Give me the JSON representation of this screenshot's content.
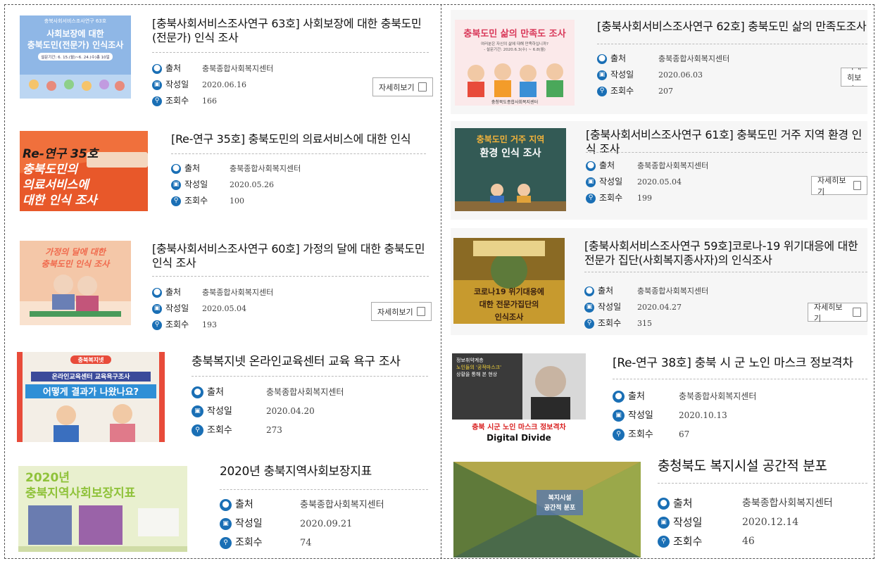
{
  "labels": {
    "source": "출처",
    "date": "작성일",
    "views": "조회수",
    "more": "자세히보기"
  },
  "left": [
    {
      "title": "[충북사회서비스조사연구 63호] 사회보장에 대한 충북도민(전문가) 인식 조사",
      "source": "충북종합사회복지센터",
      "date": "2020.06.16",
      "views": "166",
      "thumb": {
        "line1": "사회보장에 대한",
        "line2": "충북도민(전문가) 인식조사",
        "top": "충북사회서비스조사연구 63호",
        "sub": "설문기간: 6. 15.(월)~6. 24.(수)총 10일"
      }
    },
    {
      "title": "[Re-연구 35호] 충북도민의 의료서비스에 대한 인식",
      "source": "충북종합사회복지센터",
      "date": "2020.05.26",
      "views": "100",
      "thumb": {
        "line1": "Re-연구 35호",
        "line2": "충북도민의",
        "line3": "의료서비스에",
        "line4": "대한 인식 조사"
      }
    },
    {
      "title": "[충북사회서비스조사연구 60호] 가정의 달에 대한 충북도민 인식 조사",
      "source": "충북종합사회복지센터",
      "date": "2020.05.04",
      "views": "193",
      "thumb": {
        "line1": "가정의 달에 대한",
        "line2": "충북도민 인식 조사"
      }
    },
    {
      "title": "충북복지넷 온라인교육센터 교육 욕구 조사",
      "source": "충북종합사회복지센터",
      "date": "2020.04.20",
      "views": "273",
      "thumb": {
        "tag": "충북복지넷",
        "line1": "온라인교육센터 교육욕구조사",
        "line2": "어떻게 결과가 나왔나요?"
      }
    },
    {
      "title": "2020년 충북지역사회보장지표",
      "source": "충북종합사회복지센터",
      "date": "2020.09.21",
      "views": "74",
      "thumb": {
        "line1": "2020년",
        "line2": "충북지역사회보장지표"
      }
    }
  ],
  "right": [
    {
      "title": "[충북사회서비스조사연구 62호] 충북도민 삶의 만족도조사",
      "source": "충북종합사회복지센터",
      "date": "2020.06.03",
      "views": "207",
      "thumb": {
        "line1": "충북도민 삶의 만족도 조사",
        "sub": "여러분은 자신의 삶에 대해 만족하십니까?",
        "sub2": "- 설문기간: 2020.6.3(수) ~ 6.8(월)",
        "foot": "충청북도종합사회복지센터"
      }
    },
    {
      "title": "[충북사회서비스조사연구 61호] 충북도민 거주 지역 환경 인식 조사",
      "source": "충북종합사회복지센터",
      "date": "2020.05.04",
      "views": "199",
      "thumb": {
        "line1": "충북도민 거주 지역",
        "line2": "환경 인식 조사"
      }
    },
    {
      "title": "[충북사회서비스조사연구 59호]코로나-19 위기대응에 대한 전문가 집단(사회복지종사자)의 인식조사",
      "source": "충북종합사회복지센터",
      "date": "2020.04.27",
      "views": "315",
      "thumb": {
        "line1": "코로나19 위기대응에",
        "line2": "대한 전문가집단의",
        "line3": "인식조사"
      }
    },
    {
      "title": "[Re-연구 38호] 충북 시 군 노인 마스크 정보격차",
      "source": "충북종합사회복지센터",
      "date": "2020.10.13",
      "views": "67",
      "thumb": {
        "top": "정보취약계층",
        "top2": "노인들의 '공적마스크'",
        "top3": "상황을 통해 본 현상",
        "line1": "충북 시군 노인 마스크 정보격차",
        "line2": "Digital Divide"
      }
    },
    {
      "title": "충청북도 복지시설 공간적 분포",
      "source": "충북종합사회복지센터",
      "date": "2020.12.14",
      "views": "46",
      "thumb": {
        "line1": "복지시설",
        "line2": "공간적 분포"
      }
    }
  ]
}
